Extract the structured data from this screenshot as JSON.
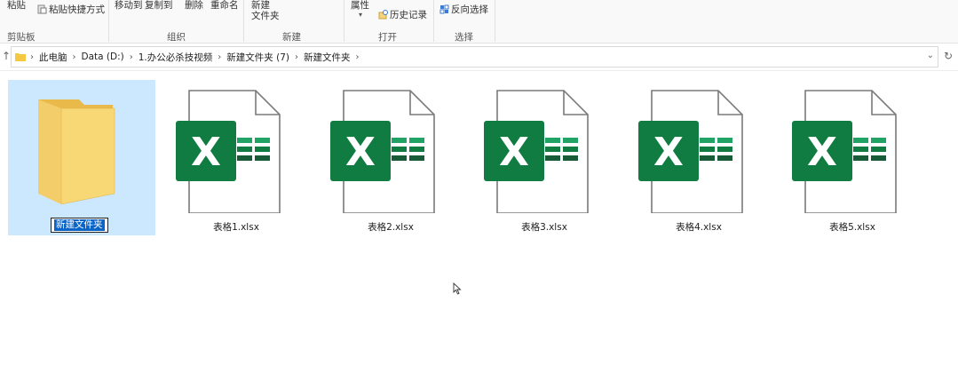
{
  "ribbon": {
    "clipboard": {
      "paste": "粘贴",
      "paste_shortcut": "粘贴快捷方式",
      "group": "剪贴板"
    },
    "organize": {
      "move_to": "移动到",
      "copy_to": "复制到",
      "delete": "删除",
      "rename": "重命名",
      "group": "组织"
    },
    "new": {
      "new_folder_line1": "新建",
      "new_folder_line2": "文件夹",
      "group": "新建"
    },
    "open": {
      "properties": "属性",
      "history": "历史记录",
      "group": "打开"
    },
    "select": {
      "invert": "反向选择",
      "group": "选择"
    }
  },
  "address": {
    "crumbs": [
      "此电脑",
      "Data (D:)",
      "1.办公必杀技视频",
      "新建文件夹 (7)",
      "新建文件夹"
    ]
  },
  "files": {
    "folder": {
      "rename_value": "新建文件夹"
    },
    "items": [
      {
        "name": "表格1.xlsx"
      },
      {
        "name": "表格2.xlsx"
      },
      {
        "name": "表格3.xlsx"
      },
      {
        "name": "表格4.xlsx"
      },
      {
        "name": "表格5.xlsx"
      }
    ],
    "excel_letter": "X"
  },
  "colors": {
    "excel_green": "#107c41",
    "selection": "#cce8ff",
    "folder": "#f8d775"
  }
}
